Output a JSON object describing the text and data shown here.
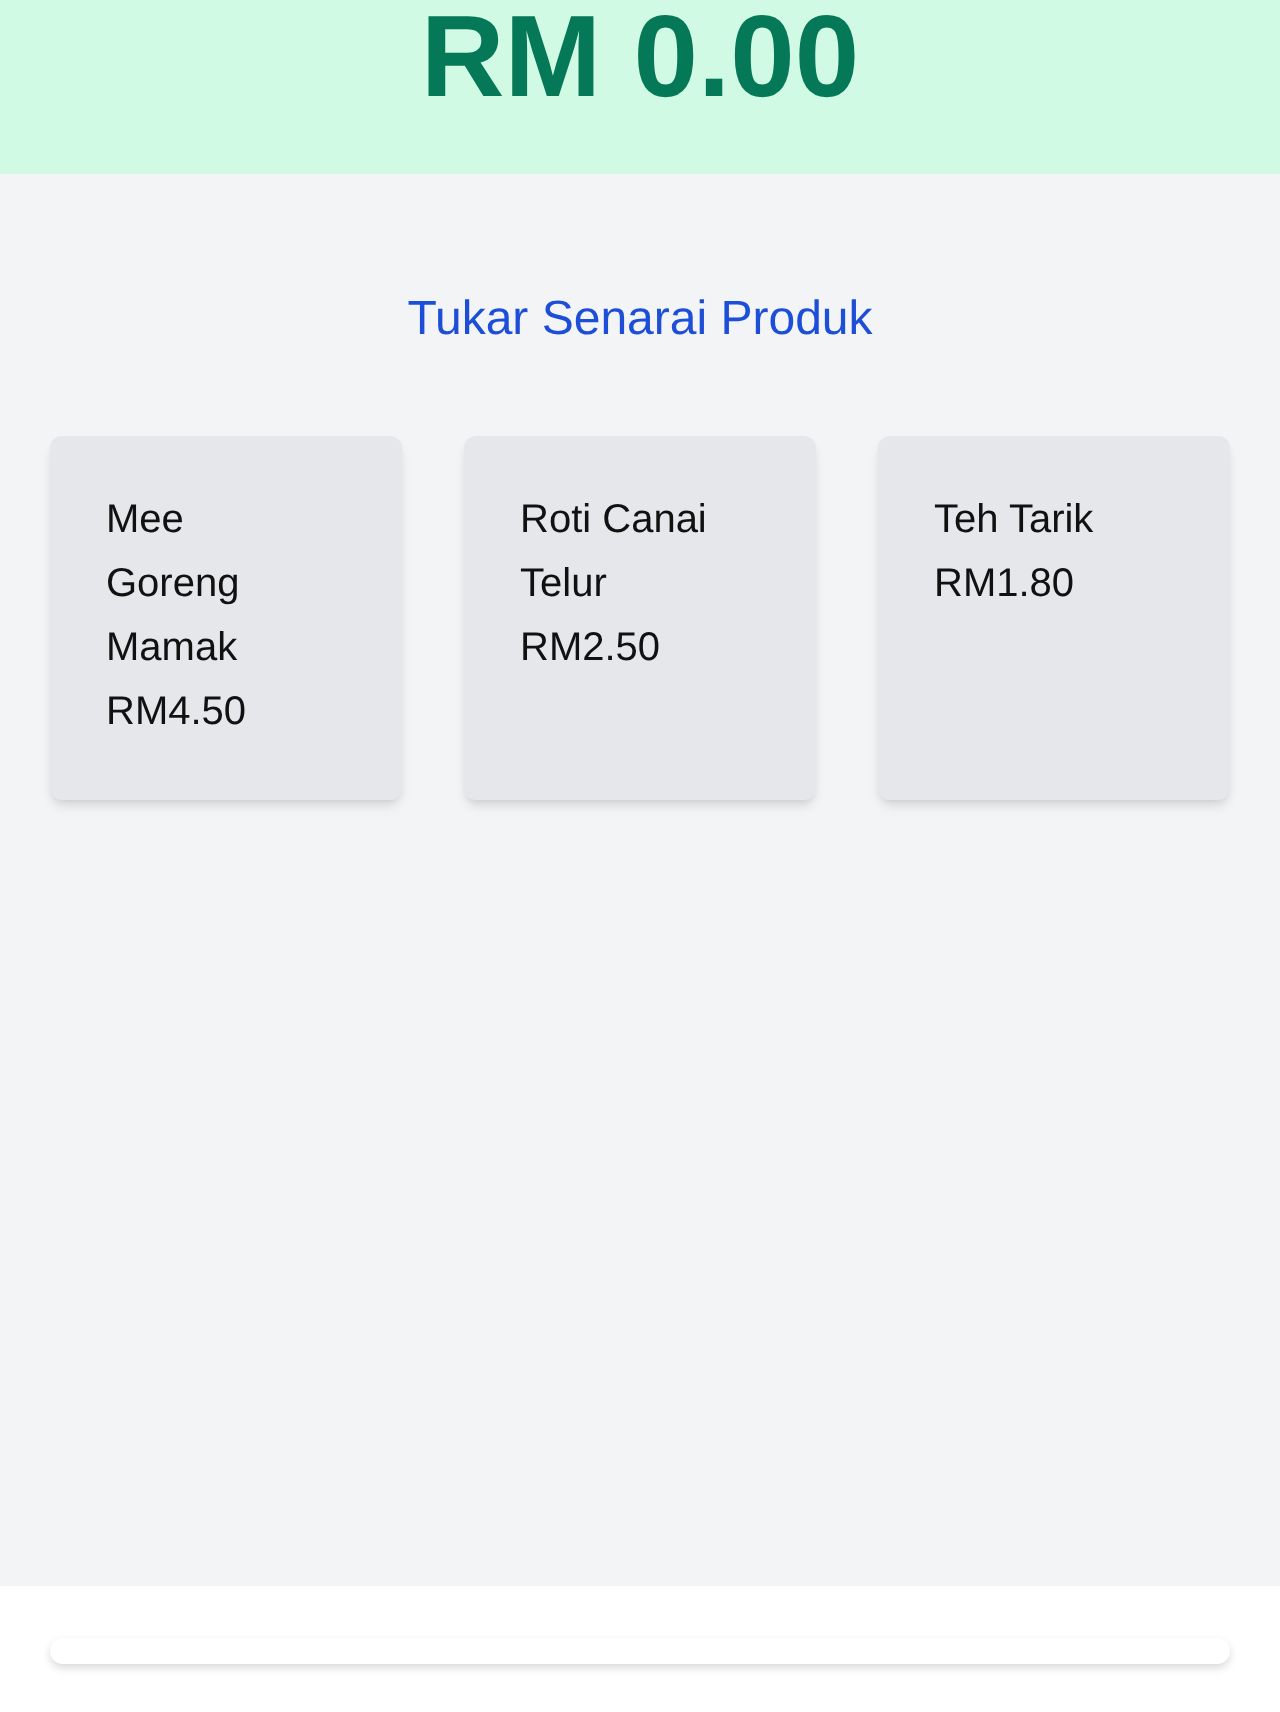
{
  "total": {
    "amount": "RM 0.00"
  },
  "switch_link": {
    "label": "Tukar Senarai Produk"
  },
  "products": [
    {
      "name": "Mee Goreng Mamak",
      "price": "RM4.50"
    },
    {
      "name": "Roti Canai Telur",
      "price": "RM2.50"
    },
    {
      "name": "Teh Tarik",
      "price": "RM1.80"
    }
  ]
}
